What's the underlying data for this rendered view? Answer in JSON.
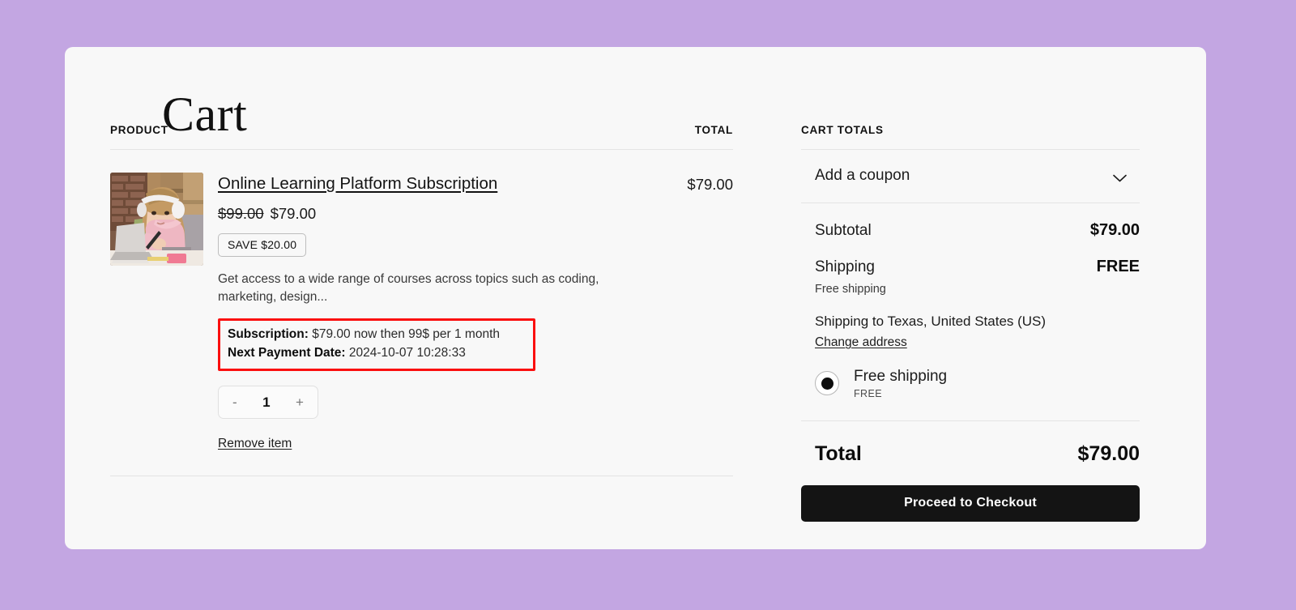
{
  "page": {
    "title": "Cart",
    "background_color": "#c3a6e2",
    "card_color": "#f8f8f8"
  },
  "product_table": {
    "headers": {
      "product": "PRODUCT",
      "total": "TOTAL"
    },
    "items": [
      {
        "title": "Online Learning Platform Subscription",
        "image_alt": "girl with headphones studying at laptop",
        "price_original": "$99.00",
        "price_current": "$79.00",
        "save_badge": "SAVE $20.00",
        "description": "Get access to a wide range of courses across topics such as coding, marketing, design...",
        "subscription_label": "Subscription:",
        "subscription_value": "$79.00 now then 99$ per 1 month",
        "next_payment_label": "Next Payment Date:",
        "next_payment_value": "2024-10-07 10:28:33",
        "highlight_border_color": "#fb0f0f",
        "quantity": "1",
        "qty_decrease": "-",
        "qty_increase": "+",
        "remove_label": "Remove item",
        "line_total": "$79.00"
      }
    ]
  },
  "cart_totals": {
    "heading": "CART TOTALS",
    "coupon_label": "Add a coupon",
    "coupon_icon": "chevron-down-icon",
    "subtotal_label": "Subtotal",
    "subtotal_value": "$79.00",
    "shipping_label": "Shipping",
    "shipping_value": "FREE",
    "shipping_method_note": "Free shipping",
    "shipping_to": "Shipping to Texas, United States (US)",
    "change_address_label": "Change address",
    "shipping_option": {
      "name": "Free shipping",
      "sub": "FREE",
      "selected": true
    },
    "total_label": "Total",
    "total_value": "$79.00",
    "checkout_label": "Proceed to Checkout",
    "checkout_bg": "#141414"
  }
}
